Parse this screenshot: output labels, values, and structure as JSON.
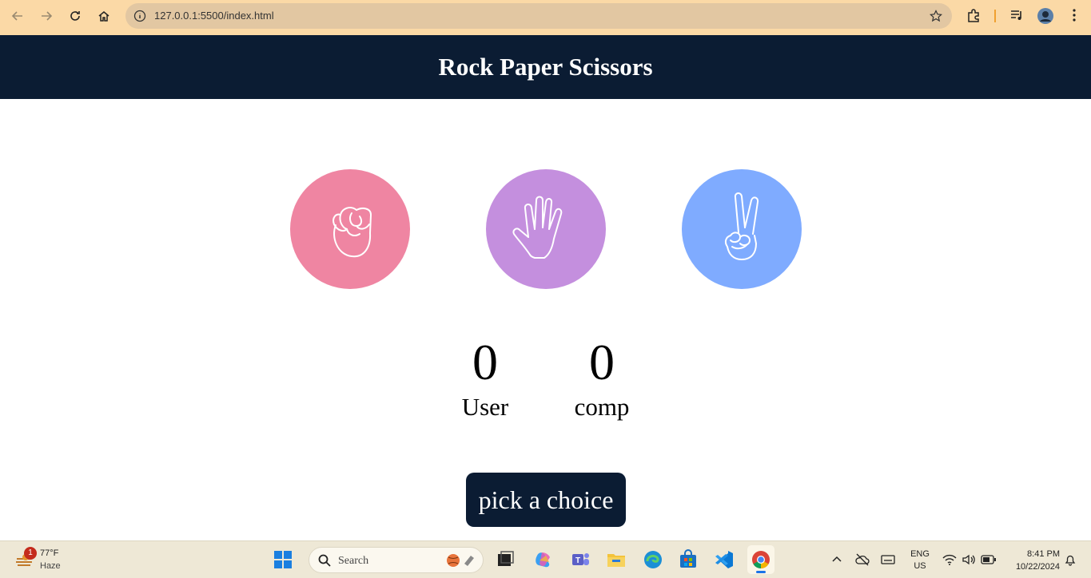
{
  "browser": {
    "url": "127.0.0.1:5500/index.html"
  },
  "app": {
    "title": "Rock Paper Scissors",
    "choices": [
      {
        "name": "rock",
        "icon": "rock-hand-icon",
        "color": "#ef85a2"
      },
      {
        "name": "paper",
        "icon": "paper-hand-icon",
        "color": "#c48fde"
      },
      {
        "name": "scissors",
        "icon": "scissors-hand-icon",
        "color": "#7fabff"
      }
    ],
    "scores": {
      "user": {
        "value": "0",
        "label": "User"
      },
      "comp": {
        "value": "0",
        "label": "comp"
      }
    },
    "message": "pick a choice",
    "header_color": "#0b1c33"
  },
  "taskbar": {
    "weather": {
      "temp": "77°F",
      "condition": "Haze",
      "badge": "1"
    },
    "search_placeholder": "Search",
    "language": {
      "lang": "ENG",
      "region": "US"
    },
    "clock": {
      "time": "8:41 PM",
      "date": "10/22/2024"
    }
  }
}
